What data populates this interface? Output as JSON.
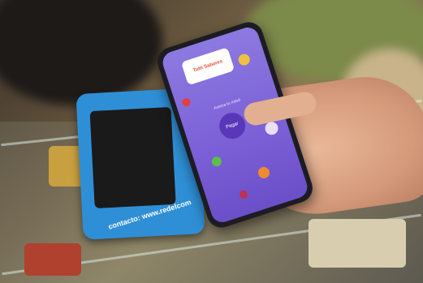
{
  "scene": {
    "terminal_brand": "contacto: www.redelcom",
    "phone_logo": "Tutti Sabores",
    "phone_prompt": "Acerca tu móvil",
    "phone_pay_button": "Pagar"
  }
}
